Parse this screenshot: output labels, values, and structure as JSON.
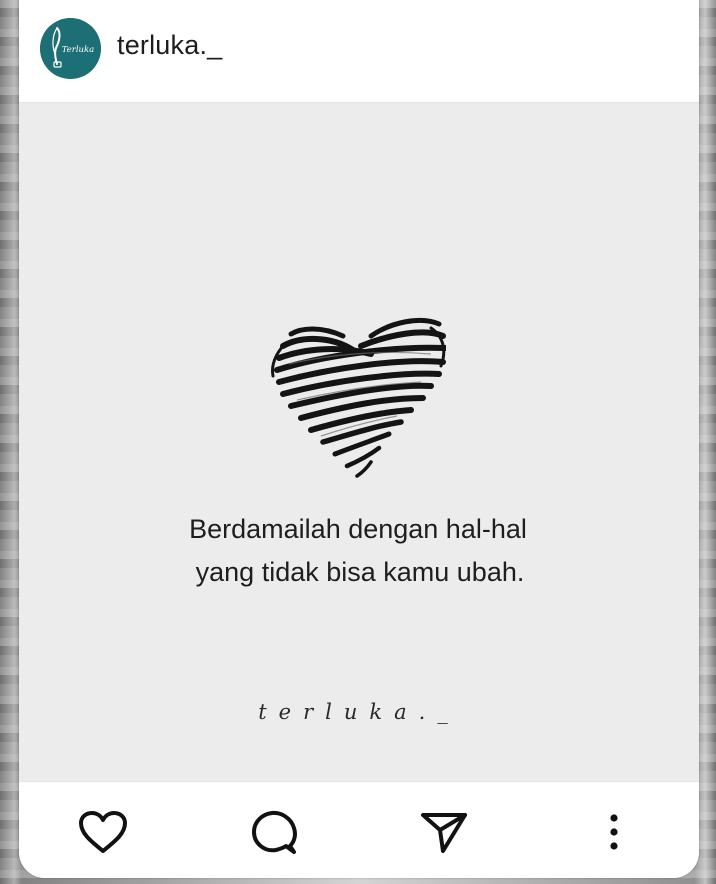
{
  "post": {
    "username": "terluka._",
    "avatar_text": "Terluka",
    "quote_line1": "Berdamailah dengan hal-hal",
    "quote_line2": "yang tidak bisa kamu ubah.",
    "signature": "terluka._"
  },
  "icons": {
    "heart_illustration": "scribble-heart-icon",
    "like": "heart-outline-icon",
    "comment": "speech-bubble-icon",
    "share": "paper-plane-icon",
    "more": "vertical-dots-icon"
  },
  "colors": {
    "avatar_bg": "#1c6f74",
    "post_bg": "#ececec",
    "text": "#1e1e1e"
  }
}
